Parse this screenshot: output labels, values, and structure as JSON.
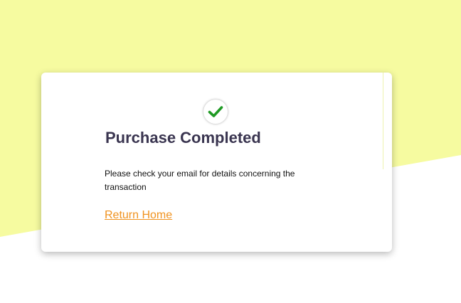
{
  "colors": {
    "background_accent": "#f6fba0",
    "link": "#f0921e",
    "title": "#3a3550",
    "check": "#1f9a24"
  },
  "confirmation": {
    "icon": "checkmark-icon",
    "title": "Purchase Completed",
    "message": "Please check your email for details concerning the transaction",
    "return_link": "Return Home"
  }
}
